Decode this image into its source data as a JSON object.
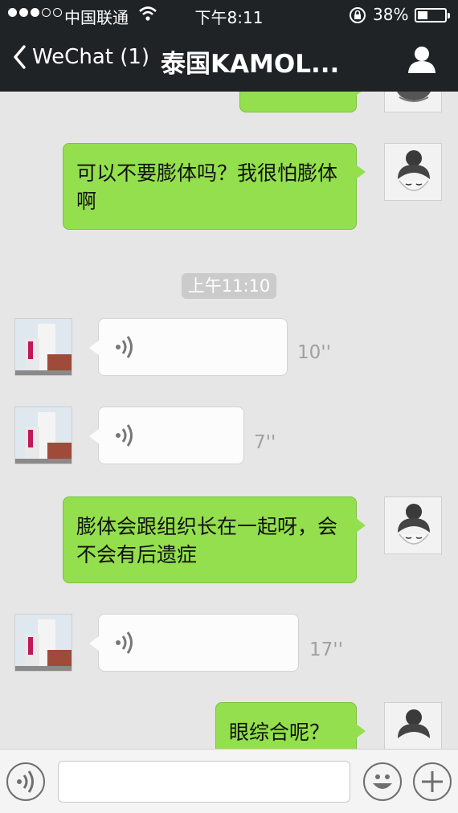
{
  "status_bar": {
    "signal_dots_filled": 3,
    "signal_dots_total": 5,
    "carrier": "中国联通",
    "time": "下午8:11",
    "battery_text": "38%",
    "battery_level": 0.38
  },
  "nav": {
    "back_label": "WeChat (1)",
    "title": "泰国KAMOL..."
  },
  "chat": {
    "messages": [
      {
        "type": "text",
        "from": "me",
        "text": "可以不要膨体吗？我很怕膨体啊"
      },
      {
        "type": "timestamp",
        "text": "上午11:10"
      },
      {
        "type": "voice",
        "from": "other",
        "duration": "10''"
      },
      {
        "type": "voice",
        "from": "other",
        "duration": "7''"
      },
      {
        "type": "text",
        "from": "me",
        "text": "膨体会跟组织长在一起呀，会不会有后遗症"
      },
      {
        "type": "voice",
        "from": "other",
        "duration": "17''"
      },
      {
        "type": "text",
        "from": "me",
        "text": "眼综合呢？"
      }
    ]
  },
  "input_bar": {
    "voice_button": "voice-input-icon",
    "text_value": "",
    "emoji_button": "smiley-icon",
    "more_button": "plus-icon"
  },
  "colors": {
    "nav_bg": "#202326",
    "chat_bg": "#e6e6e6",
    "my_bubble": "#93df4d",
    "other_bubble": "#fcfcfc"
  }
}
